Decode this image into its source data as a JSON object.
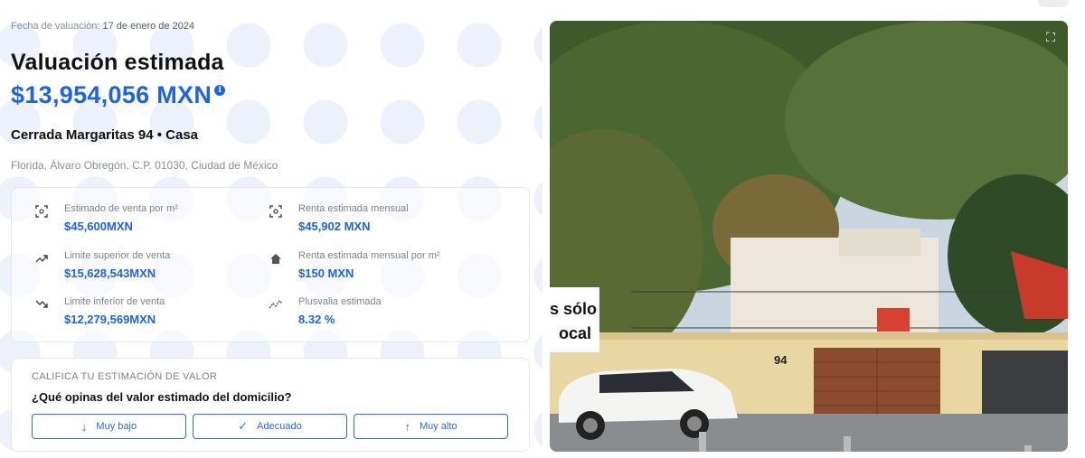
{
  "valuation": {
    "date_label": "Fecha de valuación:",
    "date_value": "17 de enero de 2024",
    "title": "Valuación estimada",
    "price": "$13,954,056 MXN",
    "info_glyph": "i"
  },
  "property": {
    "address": "Cerrada Margaritas 94 • Casa",
    "location": "Florida, Álvaro Obregón, C.P. 01030, Ciudad de México"
  },
  "stats": [
    {
      "icon": "scan-area-icon",
      "label": "Estimado de venta por m²",
      "value": "$45,600MXN"
    },
    {
      "icon": "scan-area-icon",
      "label": "Renta estimada mensual",
      "value": "$45,902 MXN"
    },
    {
      "icon": "trend-up-icon",
      "label": "Limite superior de venta",
      "value": "$15,628,543MXN"
    },
    {
      "icon": "home-icon",
      "label": "Renta estimada mensual por m²",
      "value": "$150 MXN"
    },
    {
      "icon": "trend-down-icon",
      "label": "Limite inferior de venta",
      "value": "$12,279,569MXN"
    },
    {
      "icon": "chart-line-icon",
      "label": "Plusvalia estimada",
      "value": "8.32 %"
    }
  ],
  "rating": {
    "heading": "CALIFICA TU ESTIMACIÓN DE VALOR",
    "question": "¿Qué opinas del valor estimado del domicilio?",
    "buttons": [
      {
        "icon": "arrow-down-icon",
        "glyph": "↓",
        "label": "Muy bajo"
      },
      {
        "icon": "check-icon",
        "glyph": "✓",
        "label": "Adecuado"
      },
      {
        "icon": "arrow-up-icon",
        "glyph": "↑",
        "label": "Muy alto"
      }
    ]
  },
  "photo": {
    "house_number": "94",
    "banner_text": "s sólo\nocal",
    "expand_glyph": "⛶"
  },
  "colors": {
    "accent": "#1d63e6",
    "muted_text": "#8a8f98"
  }
}
